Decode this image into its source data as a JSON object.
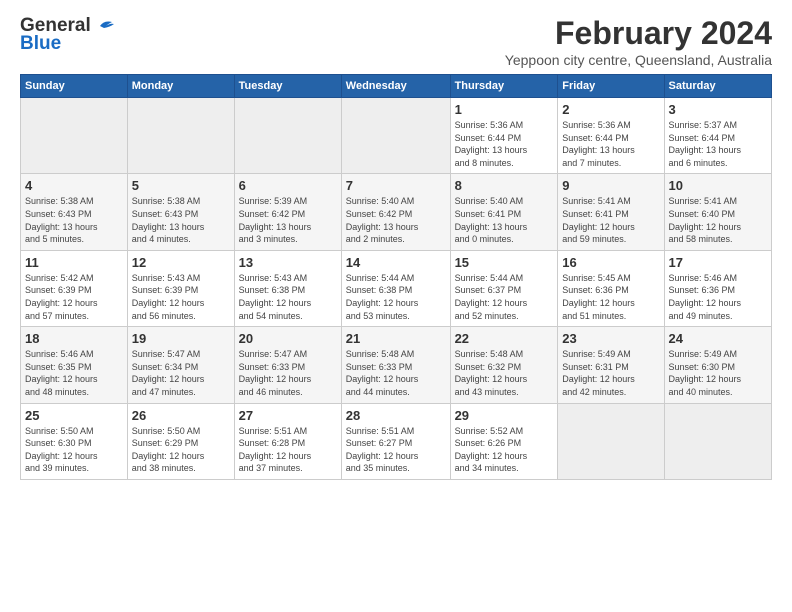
{
  "header": {
    "logo": {
      "general": "General",
      "blue": "Blue"
    },
    "title": "February 2024",
    "subtitle": "Yeppoon city centre, Queensland, Australia"
  },
  "calendar": {
    "days_of_week": [
      "Sunday",
      "Monday",
      "Tuesday",
      "Wednesday",
      "Thursday",
      "Friday",
      "Saturday"
    ],
    "weeks": [
      [
        {
          "date": "",
          "info": ""
        },
        {
          "date": "",
          "info": ""
        },
        {
          "date": "",
          "info": ""
        },
        {
          "date": "",
          "info": ""
        },
        {
          "date": "1",
          "info": "Sunrise: 5:36 AM\nSunset: 6:44 PM\nDaylight: 13 hours\nand 8 minutes."
        },
        {
          "date": "2",
          "info": "Sunrise: 5:36 AM\nSunset: 6:44 PM\nDaylight: 13 hours\nand 7 minutes."
        },
        {
          "date": "3",
          "info": "Sunrise: 5:37 AM\nSunset: 6:44 PM\nDaylight: 13 hours\nand 6 minutes."
        }
      ],
      [
        {
          "date": "4",
          "info": "Sunrise: 5:38 AM\nSunset: 6:43 PM\nDaylight: 13 hours\nand 5 minutes."
        },
        {
          "date": "5",
          "info": "Sunrise: 5:38 AM\nSunset: 6:43 PM\nDaylight: 13 hours\nand 4 minutes."
        },
        {
          "date": "6",
          "info": "Sunrise: 5:39 AM\nSunset: 6:42 PM\nDaylight: 13 hours\nand 3 minutes."
        },
        {
          "date": "7",
          "info": "Sunrise: 5:40 AM\nSunset: 6:42 PM\nDaylight: 13 hours\nand 2 minutes."
        },
        {
          "date": "8",
          "info": "Sunrise: 5:40 AM\nSunset: 6:41 PM\nDaylight: 13 hours\nand 0 minutes."
        },
        {
          "date": "9",
          "info": "Sunrise: 5:41 AM\nSunset: 6:41 PM\nDaylight: 12 hours\nand 59 minutes."
        },
        {
          "date": "10",
          "info": "Sunrise: 5:41 AM\nSunset: 6:40 PM\nDaylight: 12 hours\nand 58 minutes."
        }
      ],
      [
        {
          "date": "11",
          "info": "Sunrise: 5:42 AM\nSunset: 6:39 PM\nDaylight: 12 hours\nand 57 minutes."
        },
        {
          "date": "12",
          "info": "Sunrise: 5:43 AM\nSunset: 6:39 PM\nDaylight: 12 hours\nand 56 minutes."
        },
        {
          "date": "13",
          "info": "Sunrise: 5:43 AM\nSunset: 6:38 PM\nDaylight: 12 hours\nand 54 minutes."
        },
        {
          "date": "14",
          "info": "Sunrise: 5:44 AM\nSunset: 6:38 PM\nDaylight: 12 hours\nand 53 minutes."
        },
        {
          "date": "15",
          "info": "Sunrise: 5:44 AM\nSunset: 6:37 PM\nDaylight: 12 hours\nand 52 minutes."
        },
        {
          "date": "16",
          "info": "Sunrise: 5:45 AM\nSunset: 6:36 PM\nDaylight: 12 hours\nand 51 minutes."
        },
        {
          "date": "17",
          "info": "Sunrise: 5:46 AM\nSunset: 6:36 PM\nDaylight: 12 hours\nand 49 minutes."
        }
      ],
      [
        {
          "date": "18",
          "info": "Sunrise: 5:46 AM\nSunset: 6:35 PM\nDaylight: 12 hours\nand 48 minutes."
        },
        {
          "date": "19",
          "info": "Sunrise: 5:47 AM\nSunset: 6:34 PM\nDaylight: 12 hours\nand 47 minutes."
        },
        {
          "date": "20",
          "info": "Sunrise: 5:47 AM\nSunset: 6:33 PM\nDaylight: 12 hours\nand 46 minutes."
        },
        {
          "date": "21",
          "info": "Sunrise: 5:48 AM\nSunset: 6:33 PM\nDaylight: 12 hours\nand 44 minutes."
        },
        {
          "date": "22",
          "info": "Sunrise: 5:48 AM\nSunset: 6:32 PM\nDaylight: 12 hours\nand 43 minutes."
        },
        {
          "date": "23",
          "info": "Sunrise: 5:49 AM\nSunset: 6:31 PM\nDaylight: 12 hours\nand 42 minutes."
        },
        {
          "date": "24",
          "info": "Sunrise: 5:49 AM\nSunset: 6:30 PM\nDaylight: 12 hours\nand 40 minutes."
        }
      ],
      [
        {
          "date": "25",
          "info": "Sunrise: 5:50 AM\nSunset: 6:30 PM\nDaylight: 12 hours\nand 39 minutes."
        },
        {
          "date": "26",
          "info": "Sunrise: 5:50 AM\nSunset: 6:29 PM\nDaylight: 12 hours\nand 38 minutes."
        },
        {
          "date": "27",
          "info": "Sunrise: 5:51 AM\nSunset: 6:28 PM\nDaylight: 12 hours\nand 37 minutes."
        },
        {
          "date": "28",
          "info": "Sunrise: 5:51 AM\nSunset: 6:27 PM\nDaylight: 12 hours\nand 35 minutes."
        },
        {
          "date": "29",
          "info": "Sunrise: 5:52 AM\nSunset: 6:26 PM\nDaylight: 12 hours\nand 34 minutes."
        },
        {
          "date": "",
          "info": ""
        },
        {
          "date": "",
          "info": ""
        }
      ]
    ]
  }
}
